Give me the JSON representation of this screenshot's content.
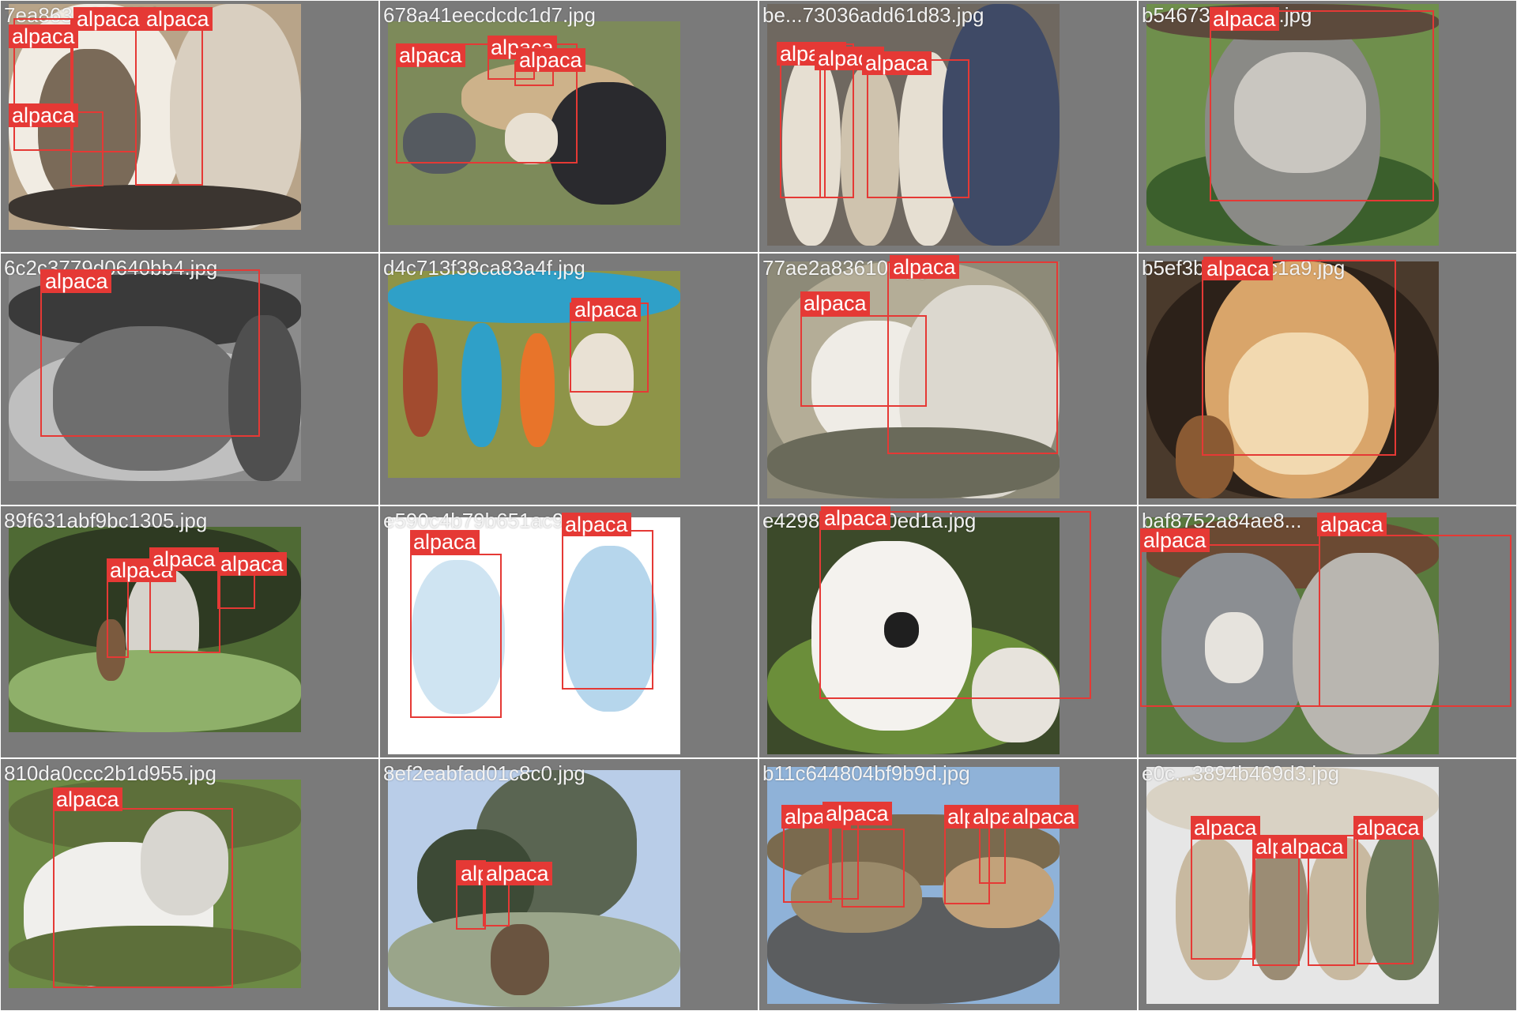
{
  "label_color": "#e53935",
  "label_text_color": "#ffffff",
  "tiles": [
    {
      "filename": "7ea863...98443.jpg",
      "photo": {
        "bg": "#b8a489",
        "scene": [
          "#f1ece3",
          "#7a6a58",
          "#d9cfc0",
          "#3b3530"
        ]
      },
      "detections": [
        {
          "label": "alpaca"
        },
        {
          "label": "alpaca"
        },
        {
          "label": "alpaca"
        },
        {
          "label": "alpaca"
        }
      ]
    },
    {
      "filename": "678a41eecdcdc1d7.jpg",
      "photo": {
        "bg": "#7d8a5a",
        "scene": [
          "#cdb28a",
          "#2a2a2e",
          "#555a60",
          "#e8e0d2"
        ]
      },
      "detections": [
        {
          "label": "alpaca"
        },
        {
          "label": "alpaca"
        },
        {
          "label": "alpaca"
        }
      ]
    },
    {
      "filename": "be...73036add61d83.jpg",
      "photo": {
        "bg": "#6f6860",
        "scene": [
          "#e6dfd2",
          "#cfc3ae",
          "#9aa4b4",
          "#3f4a66"
        ]
      },
      "detections": [
        {
          "label": "alpaca"
        },
        {
          "label": "alpaca"
        },
        {
          "label": "alpaca"
        }
      ]
    },
    {
      "filename": "b54673...1745f.jpg",
      "photo": {
        "bg": "#6f8f4c",
        "scene": [
          "#c9c6c0",
          "#8a8a86",
          "#5c4a3c",
          "#3b5f2c"
        ]
      },
      "detections": [
        {
          "label": "alpaca"
        }
      ]
    },
    {
      "filename": "6c2c3779d0640bb4.jpg",
      "photo": {
        "bg": "#8c8c8c",
        "scene": [
          "#3a3a3a",
          "#6e6e6e",
          "#bfbfbf",
          "#4f4f4f"
        ]
      },
      "detections": [
        {
          "label": "alpaca"
        }
      ]
    },
    {
      "filename": "d4c713f38ca83a4f.jpg",
      "photo": {
        "bg": "#8e9448",
        "scene": [
          "#a24b2f",
          "#2fa0c8",
          "#e8742a",
          "#e9e1d4"
        ]
      },
      "detections": [
        {
          "label": "alpaca"
        }
      ]
    },
    {
      "filename": "77ae2a83610...pg",
      "photo": {
        "bg": "#8d8a78",
        "scene": [
          "#efece6",
          "#dcd8cf",
          "#6a6a5a",
          "#b4ad97"
        ]
      },
      "detections": [
        {
          "label": "alpaca"
        },
        {
          "label": "alpaca"
        }
      ]
    },
    {
      "filename": "b5ef3b27b...6c1a9.jpg",
      "photo": {
        "bg": "#4a3a2c",
        "scene": [
          "#d9a56a",
          "#f2d9b0",
          "#8a5a33",
          "#2c2119"
        ]
      },
      "detections": [
        {
          "label": "alpaca"
        }
      ]
    },
    {
      "filename": "89f631abf9bc1305.jpg",
      "photo": {
        "bg": "#4f6a34",
        "scene": [
          "#2e3a22",
          "#d6d3cc",
          "#7b5a3e",
          "#8fb06a"
        ]
      },
      "detections": [
        {
          "label": "alpaca"
        },
        {
          "label": "alpaca"
        },
        {
          "label": "alpaca"
        }
      ]
    },
    {
      "filename": "e590c4b79b651ac9...",
      "photo": {
        "bg": "#ffffff",
        "scene": [
          "#cfe4f2",
          "#b6d6ec",
          "#ffffff",
          "#ffffff"
        ]
      },
      "detections": [
        {
          "label": "alpaca"
        },
        {
          "label": "alpaca"
        }
      ]
    },
    {
      "filename": "e4298c067c00ed1a.jpg",
      "photo": {
        "bg": "#3c4a2a",
        "scene": [
          "#f4f2ee",
          "#1f1f1f",
          "#6b8e3a",
          "#e7e3dc"
        ]
      },
      "detections": [
        {
          "label": "alpaca"
        }
      ]
    },
    {
      "filename": "baf8752a84ae8...",
      "photo": {
        "bg": "#5a7a3e",
        "scene": [
          "#8b8e92",
          "#e6e3dd",
          "#6b4a33",
          "#b9b6b0"
        ]
      },
      "detections": [
        {
          "label": "alpaca"
        },
        {
          "label": "alpaca"
        }
      ]
    },
    {
      "filename": "810da0ccc2b1d955.jpg",
      "photo": {
        "bg": "#6d8a45",
        "scene": [
          "#f0efec",
          "#d8d6d0",
          "#5d6f3a",
          "#8b7b66"
        ]
      },
      "detections": [
        {
          "label": "alpaca"
        }
      ]
    },
    {
      "filename": "8ef2eabfad01c8c0.jpg",
      "photo": {
        "bg": "#b9cde8",
        "scene": [
          "#5a6552",
          "#3d4a36",
          "#9aa58a",
          "#6a5440"
        ]
      },
      "detections": [
        {
          "label": "alpaca"
        },
        {
          "label": "alpaca"
        }
      ]
    },
    {
      "filename": "b11c644804bf9b9d.jpg",
      "photo": {
        "bg": "#8fb2d8",
        "scene": [
          "#7a6a4e",
          "#5b5d5f",
          "#9a8a6a",
          "#c2a27a"
        ]
      },
      "detections": [
        {
          "label": "alpaca"
        },
        {
          "label": "alpaca"
        },
        {
          "label": "alpaca"
        },
        {
          "label": "alpaca"
        },
        {
          "label": "alpaca"
        }
      ]
    },
    {
      "filename": "e0c...3894b469d3.jpg",
      "photo": {
        "bg": "#e6e6e6",
        "scene": [
          "#c8b9a0",
          "#9b8c74",
          "#6e7a5a",
          "#d9d2c4"
        ]
      },
      "detections": [
        {
          "label": "alpaca"
        },
        {
          "label": "alpaca"
        },
        {
          "label": "alpaca"
        },
        {
          "label": "alpaca"
        }
      ]
    }
  ]
}
